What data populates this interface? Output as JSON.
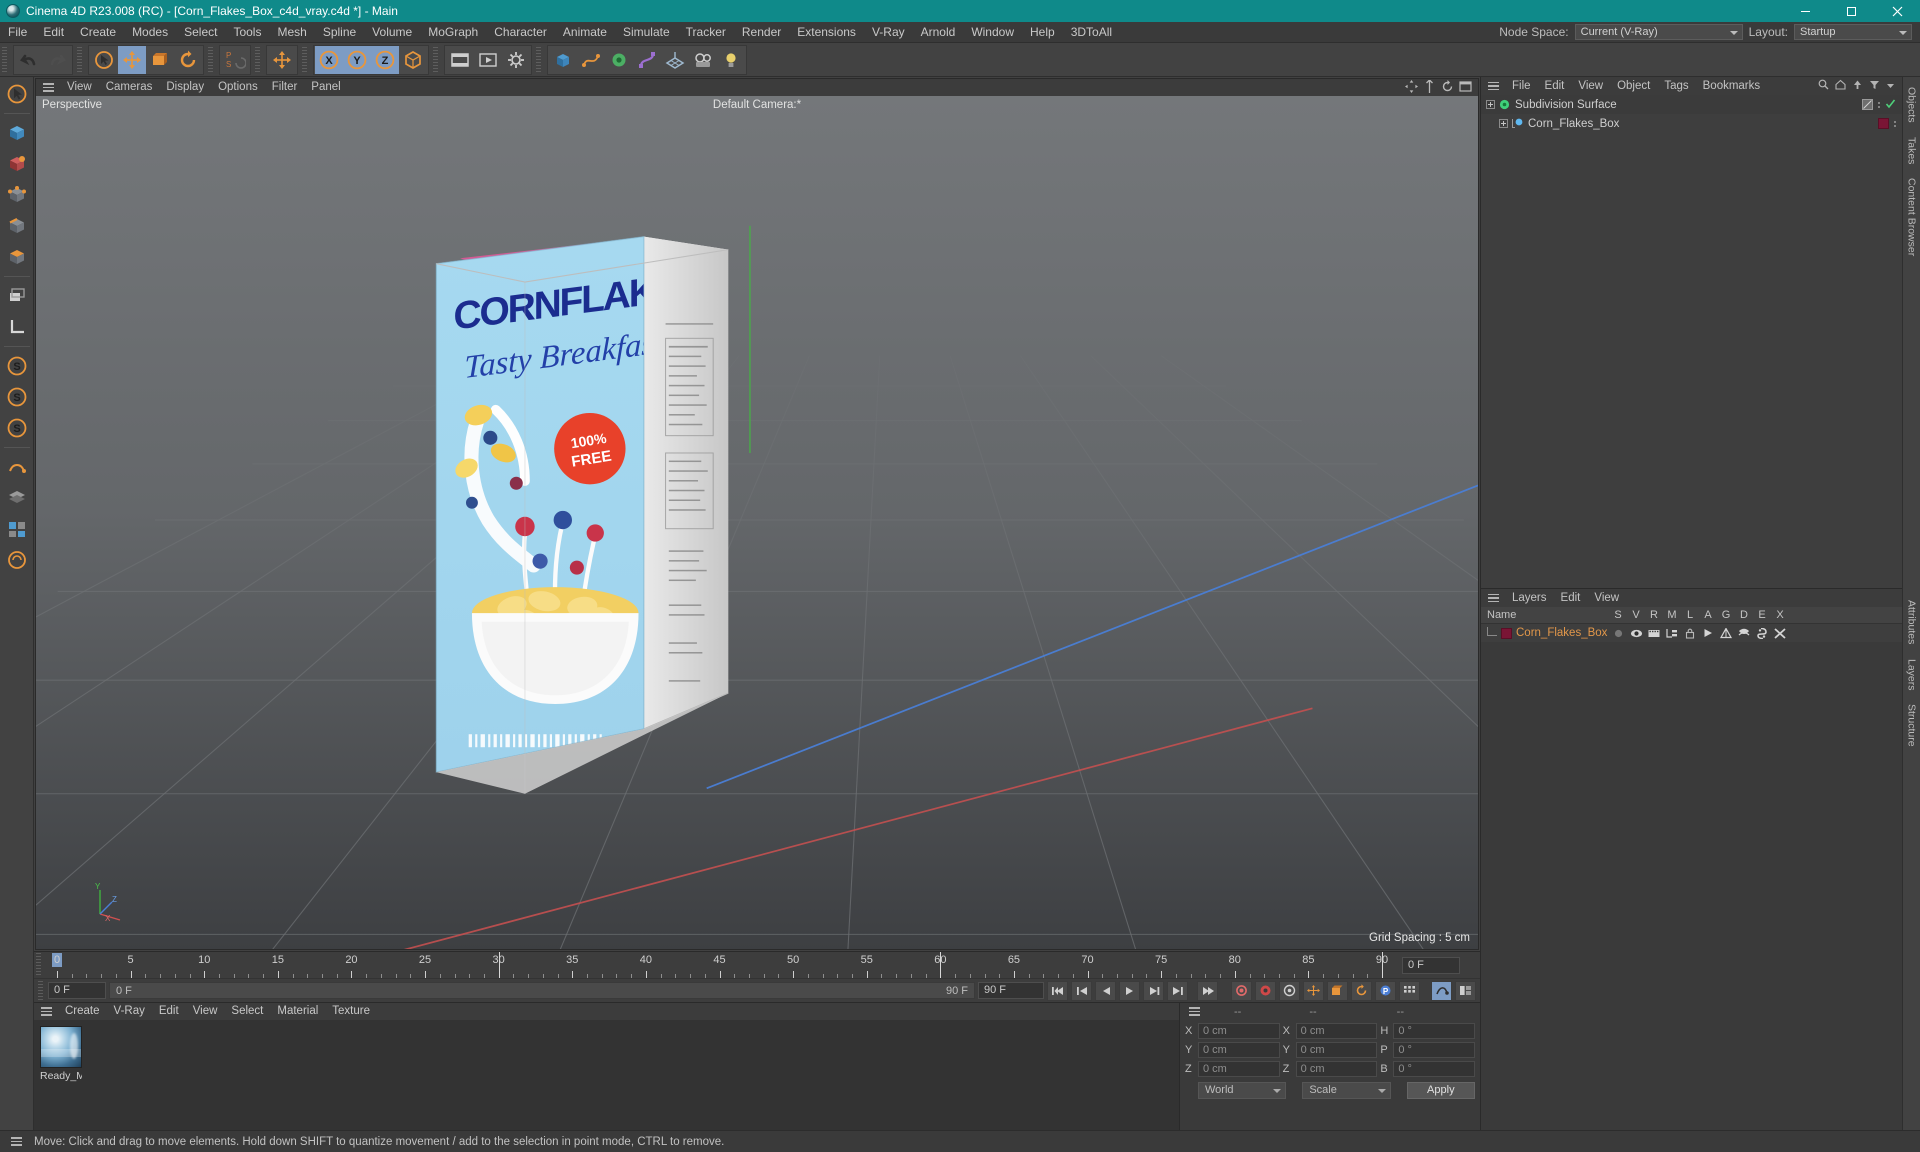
{
  "titlebar": {
    "text": "Cinema 4D R23.008 (RC) - [Corn_Flakes_Box_c4d_vray.c4d *] - Main",
    "minimize": "—",
    "maximize": "❐",
    "close": "✕",
    "accent": "#0f8a8a"
  },
  "menubar": {
    "items": [
      "File",
      "Edit",
      "Create",
      "Modes",
      "Select",
      "Tools",
      "Mesh",
      "Spline",
      "Volume",
      "MoGraph",
      "Character",
      "Animate",
      "Simulate",
      "Tracker",
      "Render",
      "Extensions",
      "V-Ray",
      "Arnold",
      "Window",
      "Help",
      "3DToAll"
    ],
    "node_space_label": "Node Space:",
    "node_space_value": "Current (V-Ray)",
    "layout_label": "Layout:",
    "layout_value": "Startup"
  },
  "toolbar": {
    "groups": [
      {
        "name": "undo-redo",
        "buttons": [
          {
            "name": "undo-button",
            "glyph": "undo",
            "active": false
          },
          {
            "name": "redo-button",
            "glyph": "redo",
            "active": false
          }
        ]
      },
      {
        "name": "transform-tools",
        "buttons": [
          {
            "name": "select-tool-button",
            "glyph": "cursor",
            "active": false
          },
          {
            "name": "move-tool-button",
            "glyph": "move",
            "active": true
          },
          {
            "name": "scale-tool-button",
            "glyph": "scale",
            "active": false
          },
          {
            "name": "rotate-tool-button",
            "glyph": "rotate",
            "active": false
          }
        ]
      },
      {
        "name": "ps-coord",
        "buttons": [
          {
            "name": "ps-toggle-button",
            "glyph": "ps",
            "active": false
          }
        ]
      },
      {
        "name": "world-axis",
        "buttons": [
          {
            "name": "world-coordinates-button",
            "glyph": "move",
            "active": false
          }
        ]
      },
      {
        "name": "axis-locks",
        "buttons": [
          {
            "name": "x-axis-lock-button",
            "glyph": "X",
            "active": true
          },
          {
            "name": "y-axis-lock-button",
            "glyph": "Y",
            "active": true
          },
          {
            "name": "z-axis-lock-button",
            "glyph": "Z",
            "active": true
          },
          {
            "name": "world-object-toggle-button",
            "glyph": "cube",
            "active": false
          }
        ]
      },
      {
        "name": "render-group",
        "buttons": [
          {
            "name": "render-view-button",
            "glyph": "film",
            "active": false
          },
          {
            "name": "render-to-picture-viewer-button",
            "glyph": "play",
            "active": false
          },
          {
            "name": "render-settings-button",
            "glyph": "gear",
            "active": false
          }
        ]
      },
      {
        "name": "primitives",
        "buttons": [
          {
            "name": "cube-primitive-button",
            "glyph": "cube",
            "active": false
          },
          {
            "name": "spline-pen-button",
            "glyph": "pen",
            "active": false
          },
          {
            "name": "generator-button",
            "glyph": "subdiv",
            "active": false
          },
          {
            "name": "deformer-button",
            "glyph": "bend",
            "active": false
          },
          {
            "name": "environment-button",
            "glyph": "floor",
            "active": false
          },
          {
            "name": "camera-button",
            "glyph": "camera",
            "active": false
          },
          {
            "name": "light-button",
            "glyph": "light",
            "active": false
          }
        ]
      }
    ]
  },
  "left_toolbar": {
    "buttons": [
      {
        "name": "live-selection-tool",
        "glyph": "cursor"
      },
      {
        "name": "model-mode-tool",
        "glyph": "cube-model"
      },
      {
        "name": "texture-mode-tool",
        "glyph": "texture"
      },
      {
        "name": "points-mode-tool",
        "glyph": "points"
      },
      {
        "name": "edges-mode-tool",
        "glyph": "edges"
      },
      {
        "name": "polygons-mode-tool",
        "glyph": "polys"
      },
      {
        "name": "enable-axis-tool",
        "glyph": "axis"
      },
      {
        "name": "workplane-tool",
        "glyph": "workplane"
      },
      {
        "name": "snap-settings-tool",
        "glyph": "S1"
      },
      {
        "name": "quantize-tool",
        "glyph": "S2"
      },
      {
        "name": "workplane-lock-tool",
        "glyph": "S3"
      },
      {
        "name": "viewport-solo-tool",
        "glyph": "solo"
      },
      {
        "name": "display-shading-tool",
        "glyph": "shade"
      },
      {
        "name": "render-region-tool",
        "glyph": "region"
      },
      {
        "name": "layer-visibility-tool",
        "glyph": "layers"
      }
    ]
  },
  "viewport": {
    "menu": [
      "View",
      "Cameras",
      "Display",
      "Options",
      "Filter",
      "Panel"
    ],
    "label": "Perspective",
    "camera_label": "Default Camera:*",
    "grid_spacing": "Grid Spacing : 5 cm",
    "axis": {
      "x": "X",
      "y": "Y",
      "z": "Z"
    },
    "product": {
      "title": "CORNFLAKES",
      "tagline": "Tasty Breakfast",
      "badge_line1": "100%",
      "badge_line2": "FREE",
      "badge_color": "#e8412a",
      "box_face_color": "#a8d9ee"
    }
  },
  "timeline": {
    "ticks": [
      0,
      5,
      10,
      15,
      20,
      25,
      30,
      35,
      40,
      45,
      50,
      55,
      60,
      65,
      70,
      75,
      80,
      85,
      90
    ],
    "current_frame_field": "0 F",
    "current_frame_marker": "0 F",
    "end_frame_left": "90 F",
    "end_frame_field": "90 F",
    "preview_end_field": "0 F",
    "transport": [
      {
        "name": "go-to-start-button",
        "glyph": "|◀◀"
      },
      {
        "name": "go-to-previous-keyframe-button",
        "glyph": "|◀"
      },
      {
        "name": "step-back-button",
        "glyph": "◀"
      },
      {
        "name": "play-button",
        "glyph": "▶"
      },
      {
        "name": "step-forward-button",
        "glyph": "▶|"
      },
      {
        "name": "go-to-next-keyframe-button",
        "glyph": "▶▶|"
      },
      {
        "name": "go-to-end-button",
        "glyph": "▶|"
      }
    ],
    "record_tools": [
      {
        "name": "record-active-objects-button",
        "glyph": "record"
      },
      {
        "name": "autokeying-button",
        "glyph": "autokey"
      },
      {
        "name": "keyframe-selection-button",
        "glyph": "keysel"
      },
      {
        "name": "position-key-button",
        "glyph": "pos"
      },
      {
        "name": "scale-key-button",
        "glyph": "scl"
      },
      {
        "name": "rotation-key-button",
        "glyph": "rot"
      },
      {
        "name": "parameter-key-button",
        "glyph": "par"
      },
      {
        "name": "point-level-animation-button",
        "glyph": "pla"
      },
      {
        "name": "motion-clip-button",
        "glyph": "clip"
      },
      {
        "name": "timeline-settings-button",
        "glyph": "set"
      }
    ]
  },
  "object_manager": {
    "menu": [
      "File",
      "Edit",
      "View",
      "Object",
      "Tags",
      "Bookmarks"
    ],
    "rows": [
      {
        "name": "Subdivision Surface",
        "type": "generator",
        "indent": 0,
        "expandable": true,
        "tag_color": "#8a8a8a",
        "checked": true
      },
      {
        "name": "Corn_Flakes_Box",
        "type": "object",
        "indent": 1,
        "expandable": true,
        "tag_color": "#7a1535",
        "checked": false
      }
    ]
  },
  "layer_manager": {
    "menu": [
      "Layers",
      "Edit",
      "View"
    ],
    "columns": [
      "Name",
      "S",
      "V",
      "R",
      "M",
      "L",
      "A",
      "G",
      "D",
      "E",
      "X"
    ],
    "rows": [
      {
        "name": "Corn_Flakes_Box",
        "color": "#7a1535"
      }
    ]
  },
  "material_manager": {
    "menu": [
      "Create",
      "V-Ray",
      "Edit",
      "View",
      "Select",
      "Material",
      "Texture"
    ],
    "materials": [
      {
        "name": "Ready_M"
      }
    ]
  },
  "coordinates": {
    "headers": [
      "--",
      "--",
      "--"
    ],
    "rows": [
      {
        "label1": "X",
        "value1": "0 cm",
        "label2": "X",
        "value2": "0 cm",
        "label3": "H",
        "value3": "0 °"
      },
      {
        "label1": "Y",
        "value1": "0 cm",
        "label2": "Y",
        "value2": "0 cm",
        "label3": "P",
        "value3": "0 °"
      },
      {
        "label1": "Z",
        "value1": "0 cm",
        "label2": "Z",
        "value2": "0 cm",
        "label3": "B",
        "value3": "0 °"
      }
    ],
    "space_select": "World",
    "mode_select": "Scale",
    "apply_button": "Apply"
  },
  "right_tabs": [
    "Objects",
    "Takes",
    "Content Browser",
    "Attributes",
    "Layers",
    "Structure"
  ],
  "statusbar": {
    "message": "Move: Click and drag to move elements. Hold down SHIFT to quantize movement / add to the selection in point mode, CTRL to remove."
  }
}
